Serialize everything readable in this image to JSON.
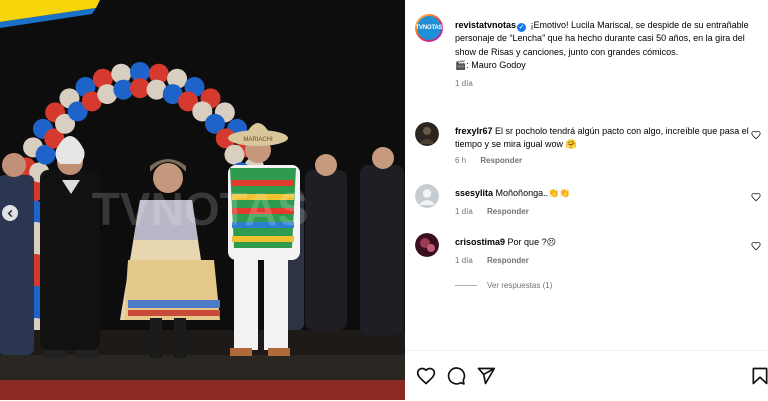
{
  "post": {
    "avatar_label": "TVNOTAS",
    "username": "revistatvnotas",
    "verified_mark": "✓",
    "caption": "¡Emotivo! Lucila Mariscal, se despide de su entrañable personaje de “Lencha” que ha hecho durante casi 50 años, en la gira del show de Risas y canciones, junto con grandes cómicos.",
    "credit": "🎬: Mauro Godoy",
    "time": "1 día"
  },
  "photo": {
    "watermark": "TVNOTAS",
    "hat_text": "MARIACHI",
    "prev_icon": "chevron-left-icon"
  },
  "comments": [
    {
      "username": "frexylr67",
      "text": "El sr pocholo tendrá algún pacto con algo, increíble que pasa el tiempo y se mira igual wow 🤗",
      "time": "6 h",
      "reply": "Responder"
    },
    {
      "username": "ssesylita",
      "text": "Moñoñonga..👏👏",
      "time": "1 día",
      "reply": "Responder"
    },
    {
      "username": "crisostima9",
      "text": "Por que ?😣",
      "time": "1 día",
      "reply": "Responder"
    }
  ],
  "view_replies": "Ver respuestas (1)",
  "actions": [
    "heart-icon",
    "comment-icon",
    "share-icon",
    "bookmark-icon"
  ],
  "colors": {
    "verified": "#1877f2",
    "muted": "#737373",
    "brand": "#1f8fd6"
  }
}
